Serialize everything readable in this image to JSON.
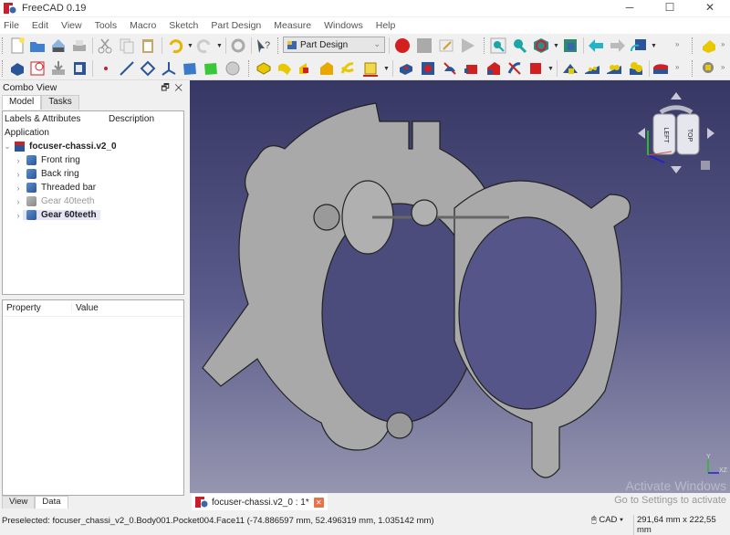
{
  "window": {
    "title": "FreeCAD 0.19",
    "controls": [
      "minimize",
      "maximize",
      "close"
    ]
  },
  "menu": [
    "File",
    "Edit",
    "View",
    "Tools",
    "Macro",
    "Sketch",
    "Part Design",
    "Measure",
    "Windows",
    "Help"
  ],
  "toolbar": {
    "workbench": "Part Design",
    "row1_icons": [
      "new-icon",
      "open-icon",
      "save-icon",
      "print-icon",
      "cut-icon",
      "copy-icon",
      "paste-icon",
      "undo-icon",
      "redo-icon",
      "refresh-icon",
      "whats-this-icon",
      "macro-record-icon",
      "macro-stop-icon",
      "macro-edit-icon",
      "macro-run-icon",
      "fit-all-icon",
      "fit-selection-icon",
      "draw-style-icon",
      "bounding-box-icon",
      "back-icon",
      "forward-icon",
      "std-views-icon",
      "measure-icon"
    ],
    "row2_icons": [
      "body-icon",
      "sketch-icon",
      "import-icon",
      "clone-icon",
      "point-icon",
      "line-icon",
      "plane-icon",
      "lcs-icon",
      "shape-binder-icon",
      "subshape-binder-icon",
      "clone-tool-icon",
      "pad-icon",
      "revolution-icon",
      "additive-loft-icon",
      "additive-pipe-icon",
      "additive-helix-icon",
      "additive-box-icon",
      "pocket-icon",
      "hole-icon",
      "groove-icon",
      "subtractive-loft-icon",
      "subtractive-pipe-icon",
      "subtractive-helix-icon",
      "subtractive-box-icon",
      "mirrored-icon",
      "linear-pattern-icon",
      "polar-pattern-icon",
      "multitransform-icon",
      "fillet-icon",
      "measure-linear-icon"
    ]
  },
  "combo": {
    "title": "Combo View",
    "tabs": [
      "Model",
      "Tasks"
    ],
    "active_tab": "Model",
    "tree": {
      "columns": [
        "Labels & Attributes",
        "Description"
      ],
      "root": "Application",
      "document": "focuser-chassi.v2_0",
      "items": [
        {
          "label": "Front ring",
          "hidden": false
        },
        {
          "label": "Back ring",
          "hidden": false
        },
        {
          "label": "Threaded bar",
          "hidden": false
        },
        {
          "label": "Gear 40teeth",
          "hidden": true
        },
        {
          "label": "Gear 60teeth",
          "hidden": false,
          "selected": true
        }
      ]
    },
    "properties": {
      "columns": [
        "Property",
        "Value"
      ],
      "tabs": [
        "View",
        "Data"
      ],
      "active_tab": "Data"
    }
  },
  "document_tab": {
    "label": "focuser-chassi.v2_0 : 1*"
  },
  "navcube": {
    "faces": [
      "LEFT",
      "TOP"
    ],
    "axes": [
      "X",
      "Y",
      "Z"
    ]
  },
  "axis_indicator": {
    "labels": [
      "Y",
      "XZ"
    ]
  },
  "watermark": {
    "title": "Activate Windows",
    "subtitle": "Go to Settings to activate"
  },
  "status": {
    "preselected": "Preselected: focuser_chassi_v2_0.Body001.Pocket004.Face11 (-74.886597 mm, 52.496319 mm, 1.035142 mm)",
    "nav_style": "CAD",
    "dimensions": "291,64 mm x 222,55 mm"
  }
}
